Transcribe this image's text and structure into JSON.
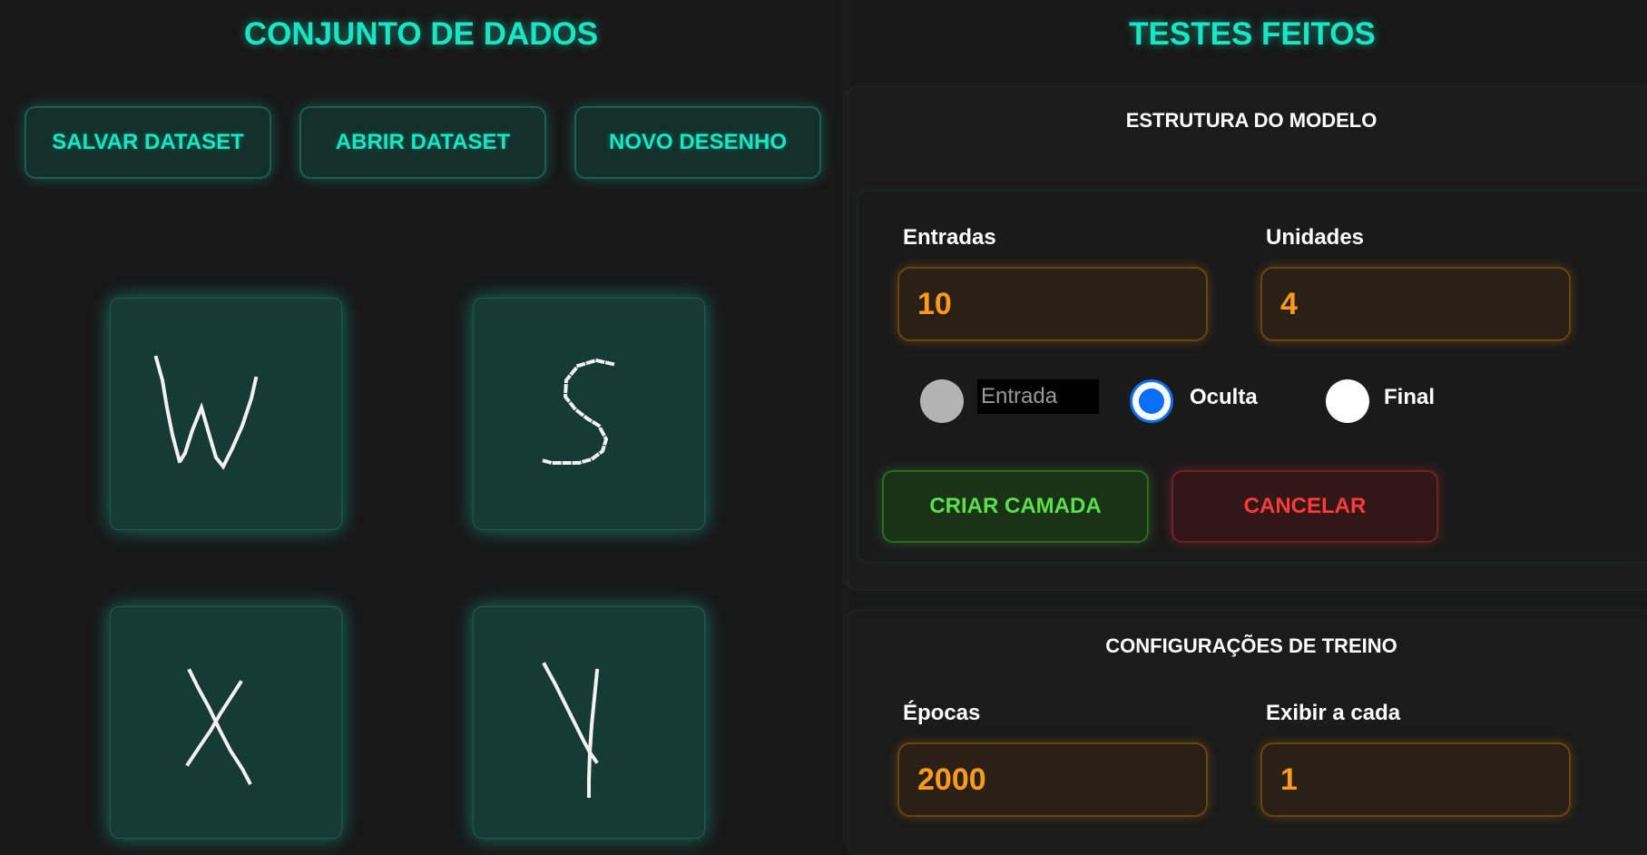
{
  "dataset": {
    "title": "CONJUNTO DE DADOS",
    "buttons": {
      "save": "SALVAR DATASET",
      "open": "ABRIR DATASET",
      "new": "NOVO DESENHO"
    },
    "drawings": [
      "W",
      "S",
      "X",
      "Y"
    ]
  },
  "tests": {
    "title": "TESTES FEITOS",
    "model": {
      "title": "ESTRUTURA DO MODELO",
      "inputs_label": "Entradas",
      "inputs_value": "10",
      "units_label": "Unidades",
      "units_value": "4",
      "layer_types": {
        "input": "Entrada",
        "hidden": "Oculta",
        "final": "Final",
        "selected": "Oculta"
      },
      "create_button": "CRIAR CAMADA",
      "cancel_button": "CANCELAR"
    },
    "training": {
      "title": "CONFIGURAÇÕES DE TREINO",
      "epochs_label": "Épocas",
      "epochs_value": "2000",
      "display_label": "Exibir a cada",
      "display_value": "1"
    }
  },
  "colors": {
    "accent": "#18e6c3",
    "orange": "#ff9a1a",
    "green": "#5ae04a",
    "red": "#ff3b3b",
    "radio_selected": "#0b6ff5"
  }
}
